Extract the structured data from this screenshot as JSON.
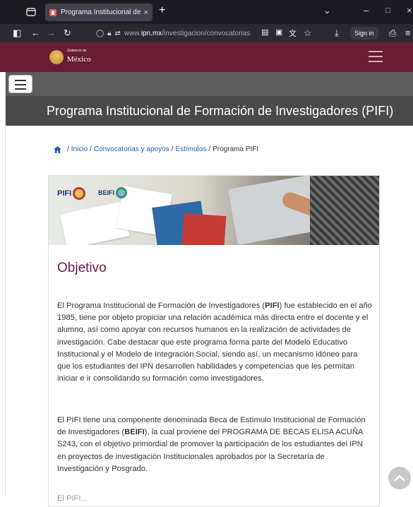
{
  "browser": {
    "tab_title": "Programa Institucional de Form",
    "tab_close": "×",
    "new_tab": "+",
    "url_prefix": "www.",
    "url_domain": "ipn.mx",
    "url_path": "/investigacion/convocatorias",
    "sign_in": "Sign in"
  },
  "gobierno": {
    "small": "Gobierno de",
    "big": "México"
  },
  "page": {
    "title": "Programa Institucional de Formación de Investigadores (PIFI)"
  },
  "breadcrumb": {
    "items": [
      "Inicio",
      "Convocatorias y apoyos",
      "Estímulos"
    ],
    "current": "Programa PIFI",
    "separator": "/"
  },
  "banner": {
    "logo1": "PIFI",
    "logo2": "BEIFI"
  },
  "content": {
    "heading": "Objetivo",
    "p1_a": "El Programa Institucional de Formación de Investigadores (",
    "p1_b": "PIFI",
    "p1_c": ") fue establecido en el año 1985, tiene por objeto propiciar una relación académica más directa entre el docente y el alumno, así como apoyar con recursos humanos en la realización de actividades de investigación. Cabe destacar que este programa forma parte del Modelo Educativo Institucional y el Modelo de Integración Social, siendo así, un mecanismo idóneo para que los estudiantes del IPN desarrollen habilidades y competencias que les permitan iniciar e ir consolidando su formación como investigadores.",
    "p2_a": "El PIFI tiene una componente denominada Beca de Estímulo Institucional de Formación de Investigadores (",
    "p2_b": "BEIFI",
    "p2_c": "), la cual proviene del PROGRAMA DE BECAS ELISA ACUÑA S243, con el objetivo primordial de promover la participación de los estudiantes del IPN en proyectos de investigación Institucionales aprobados por la Secretaría de Investigación y Posgrado.",
    "p3": "El PIFI..."
  }
}
